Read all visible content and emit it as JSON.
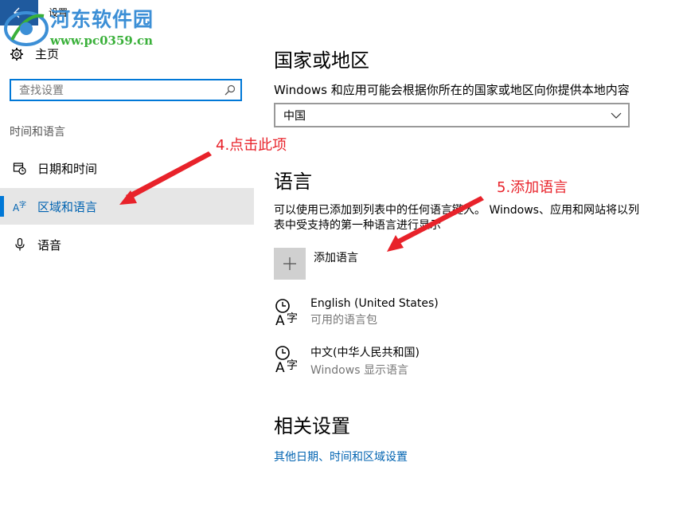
{
  "window": {
    "title": "设置"
  },
  "watermark": {
    "name": "河东软件园",
    "url": "www.pc0359.cn"
  },
  "sidebar": {
    "home_label": "主页",
    "search_placeholder": "查找设置",
    "section_label": "时间和语言",
    "items": [
      {
        "label": "日期和时间",
        "icon": "calendar-clock-icon"
      },
      {
        "label": "区域和语言",
        "icon": "language-icon",
        "active": true
      },
      {
        "label": "语音",
        "icon": "microphone-icon"
      }
    ]
  },
  "main": {
    "region": {
      "title": "国家或地区",
      "description": "Windows 和应用可能会根据你所在的国家或地区向你提供本地内容",
      "selected_country": "中国"
    },
    "language": {
      "title": "语言",
      "description": "可以使用已添加到列表中的任何语言键入。 Windows、应用和网站将以列表中受支持的第一种语言进行显示",
      "add_label": "添加语言",
      "items": [
        {
          "name": "English (United States)",
          "status": "可用的语言包"
        },
        {
          "name": "中文(中华人民共和国)",
          "status": "Windows 显示语言"
        }
      ]
    },
    "related": {
      "title": "相关设置",
      "link": "其他日期、时间和区域设置"
    }
  },
  "annotations": {
    "step4": "4.点击此项",
    "step5": "5.添加语言",
    "color": "#e8222a"
  },
  "colors": {
    "accent": "#0078d7",
    "active_text": "#0063b1",
    "back_button": "#1f5a9e"
  }
}
